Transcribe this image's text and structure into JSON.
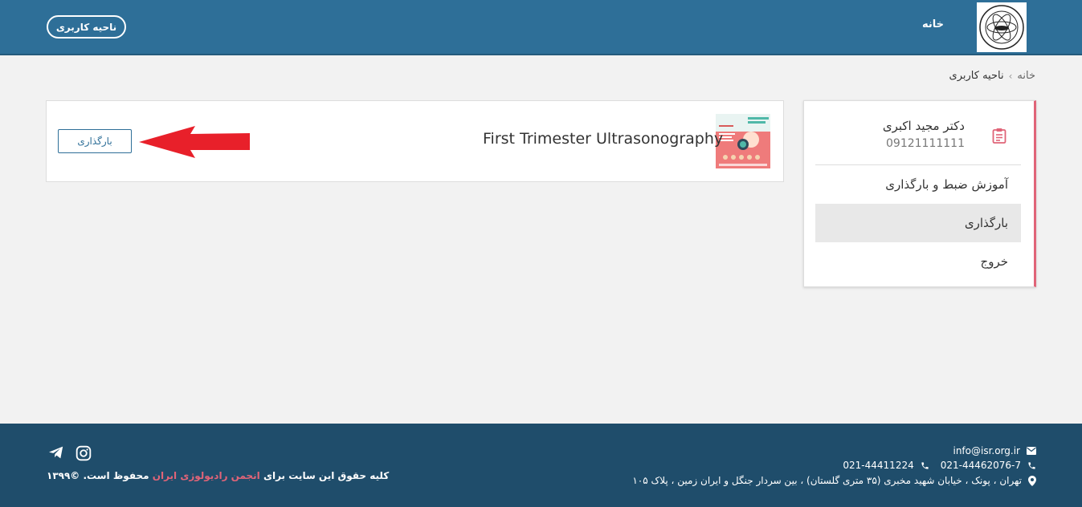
{
  "header": {
    "nav_home": "خانه",
    "user_area_button": "ناحیه کاربری"
  },
  "breadcrumb": {
    "home": "خانه",
    "separator": "›",
    "current": "ناحیه کاربری"
  },
  "sidebar": {
    "profile": {
      "name": "دکتر مجید اکبری",
      "phone": "09121111111",
      "icon": "clipboard-icon"
    },
    "menu": [
      {
        "label": "آموزش ضبط و بارگذاری",
        "active": false
      },
      {
        "label": "بارگذاری",
        "active": true
      },
      {
        "label": "خروج",
        "active": false
      }
    ]
  },
  "content": {
    "course_title": "First Trimester Ultrasonography",
    "download_button": "بارگذاری"
  },
  "footer": {
    "email": "info@isr.org.ir",
    "phone1": "021-44462076-7",
    "phone2": "021-44411224",
    "address": "تهران ، پونک ، خیابان شهید مخبری (۳۵ متری گلستان) ، بین سردار جنگل و ایران زمین ، پلاک ۱۰۵",
    "copyright_prefix": "کلیه حقوق این سایت برای",
    "copyright_org": "انجمن رادیولوژی ایران",
    "copyright_suffix": "محفوظ است. ©۱۳۹۹"
  },
  "colors": {
    "header": "#2e6f98",
    "footer": "#1f4d6b",
    "accent": "#e06478",
    "arrow": "#e8202a"
  }
}
